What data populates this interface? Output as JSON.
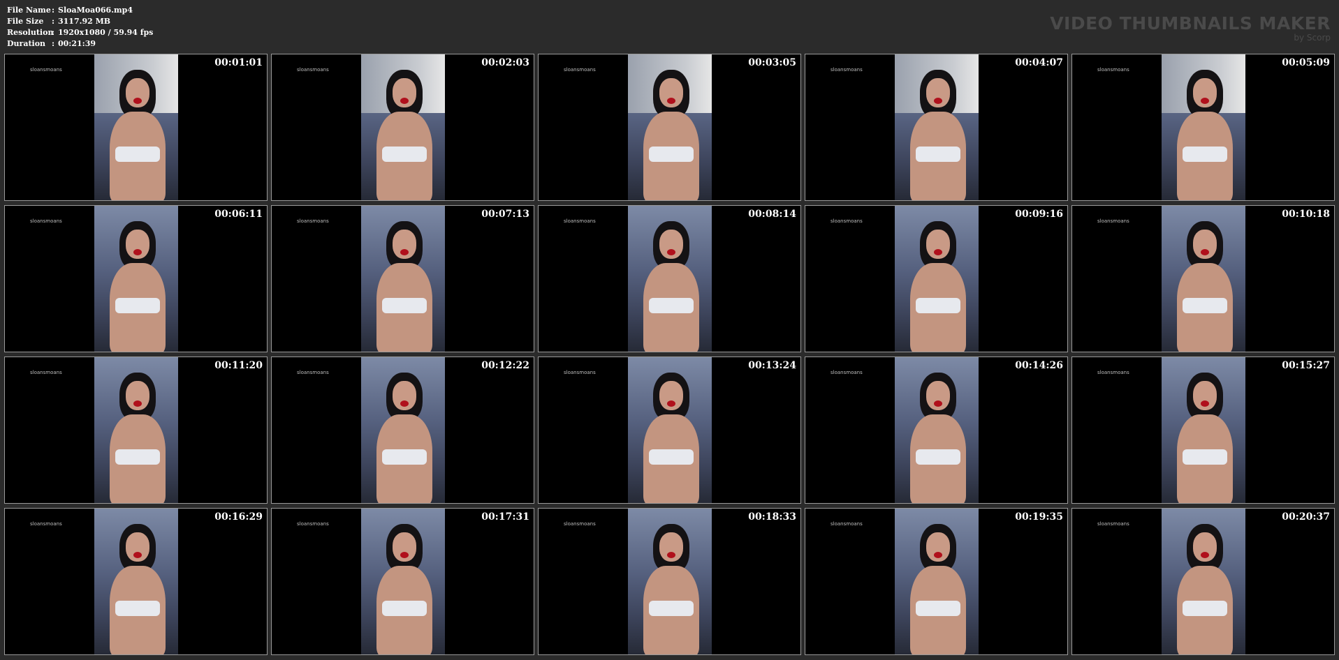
{
  "info": {
    "rows": [
      {
        "label": "File Name",
        "sep": ":",
        "value": "SloaMoa066.mp4"
      },
      {
        "label": "File Size",
        "sep": ":",
        "value": "3117.92 MB"
      },
      {
        "label": "Resolution",
        "sep": ":",
        "value": "1920x1080 / 59.94 fps"
      },
      {
        "label": "Duration",
        "sep": ":",
        "value": "00:21:39"
      }
    ]
  },
  "brand": {
    "title": "VIDEO THUMBNAILS MAKER",
    "subtitle": "by Scorp"
  },
  "watermark": "sloansmoans",
  "thumbnails": [
    {
      "time": "00:01:01"
    },
    {
      "time": "00:02:03"
    },
    {
      "time": "00:03:05"
    },
    {
      "time": "00:04:07"
    },
    {
      "time": "00:05:09"
    },
    {
      "time": "00:06:11"
    },
    {
      "time": "00:07:13"
    },
    {
      "time": "00:08:14"
    },
    {
      "time": "00:09:16"
    },
    {
      "time": "00:10:18"
    },
    {
      "time": "00:11:20"
    },
    {
      "time": "00:12:22"
    },
    {
      "time": "00:13:24"
    },
    {
      "time": "00:14:26"
    },
    {
      "time": "00:15:27"
    },
    {
      "time": "00:16:29"
    },
    {
      "time": "00:17:31"
    },
    {
      "time": "00:18:33"
    },
    {
      "time": "00:19:35"
    },
    {
      "time": "00:20:37"
    }
  ]
}
